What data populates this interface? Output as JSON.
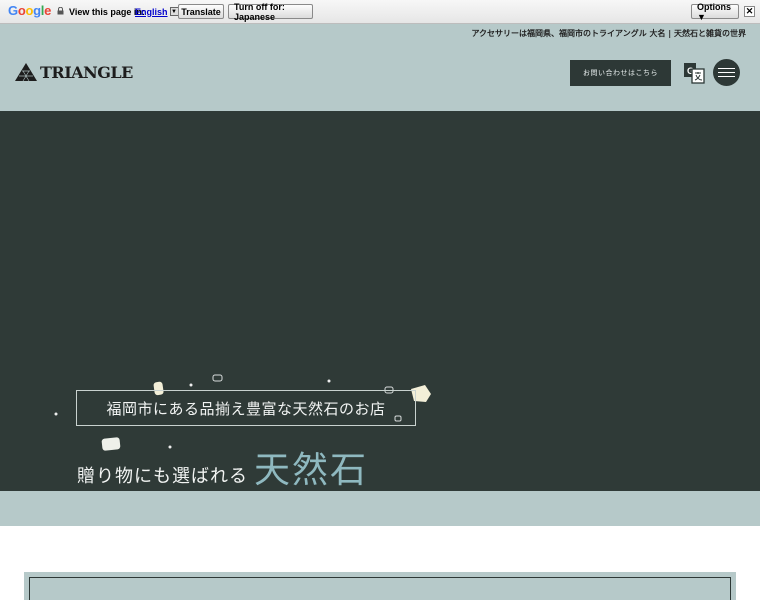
{
  "translate_bar": {
    "logo_letters": [
      "G",
      "o",
      "o",
      "g",
      "l",
      "e"
    ],
    "view_text": "View this page in:",
    "language": "English",
    "translate_label": "Translate",
    "turn_off_label": "Turn off for: Japanese",
    "options_label": "Options ▼",
    "close_label": "✕"
  },
  "header": {
    "tagline": "アクセサリーは福岡県、福岡市のトライアングル 大名 | 天然石と雑貨の世界",
    "logo_text": "TRIANGLE",
    "contact_label": "お問い合わせはこちら"
  },
  "hero": {
    "subtitle": "福岡市にある品揃え豊富な天然石のお店",
    "title_small": "贈り物にも選ばれる",
    "title_big": "天然石"
  },
  "colors": {
    "header_bg": "#b6c9c9",
    "hero_bg": "#2f3a37",
    "button_bg": "#2d3836",
    "accent": "#8fb9c0"
  }
}
